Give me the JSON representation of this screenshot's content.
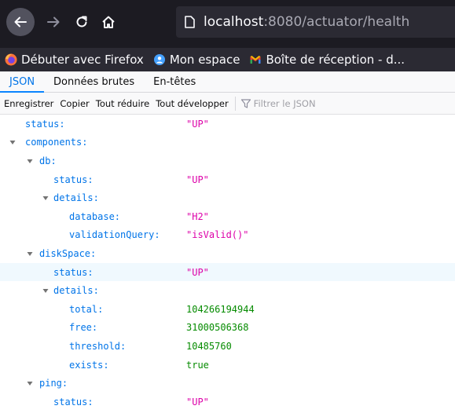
{
  "browser": {
    "url_host": "localhost",
    "url_rest": ":8080/actuator/health",
    "bookmarks": [
      {
        "label": "Débuter avec Firefox",
        "icon": "firefox-icon"
      },
      {
        "label": "Mon espace",
        "icon": "mon-espace-icon"
      },
      {
        "label": "Boîte de réception - d...",
        "icon": "gmail-icon"
      }
    ]
  },
  "viewer": {
    "tabs": [
      "JSON",
      "Données brutes",
      "En-têtes"
    ],
    "active_tab": "JSON",
    "actions": {
      "save": "Enregistrer",
      "copy": "Copier",
      "collapse_all": "Tout réduire",
      "expand_all": "Tout développer",
      "filter_placeholder": "Filtrer le JSON"
    }
  },
  "tree": [
    {
      "key": "status:",
      "value": "\"UP\"",
      "type": "str",
      "depth": 0,
      "expandable": false
    },
    {
      "key": "components:",
      "value": "",
      "type": "obj",
      "depth": 0,
      "expandable": true
    },
    {
      "key": "db:",
      "value": "",
      "type": "obj",
      "depth": 1,
      "expandable": true
    },
    {
      "key": "status:",
      "value": "\"UP\"",
      "type": "str",
      "depth": 2,
      "expandable": false
    },
    {
      "key": "details:",
      "value": "",
      "type": "obj",
      "depth": 2,
      "expandable": true
    },
    {
      "key": "database:",
      "value": "\"H2\"",
      "type": "str",
      "depth": 3,
      "expandable": false
    },
    {
      "key": "validationQuery:",
      "value": "\"isValid()\"",
      "type": "str",
      "depth": 3,
      "expandable": false
    },
    {
      "key": "diskSpace:",
      "value": "",
      "type": "obj",
      "depth": 1,
      "expandable": true
    },
    {
      "key": "status:",
      "value": "\"UP\"",
      "type": "str",
      "depth": 2,
      "expandable": false,
      "highlight": true
    },
    {
      "key": "details:",
      "value": "",
      "type": "obj",
      "depth": 2,
      "expandable": true
    },
    {
      "key": "total:",
      "value": "104266194944",
      "type": "num",
      "depth": 3,
      "expandable": false
    },
    {
      "key": "free:",
      "value": "31000506368",
      "type": "num",
      "depth": 3,
      "expandable": false
    },
    {
      "key": "threshold:",
      "value": "10485760",
      "type": "num",
      "depth": 3,
      "expandable": false
    },
    {
      "key": "exists:",
      "value": "true",
      "type": "bool",
      "depth": 3,
      "expandable": false
    },
    {
      "key": "ping:",
      "value": "",
      "type": "obj",
      "depth": 1,
      "expandable": true
    },
    {
      "key": "status:",
      "value": "\"UP\"",
      "type": "str",
      "depth": 2,
      "expandable": false
    }
  ],
  "colors": {
    "chrome_bg": "#1c1b22",
    "bookmarks_bg": "#2b2a33",
    "key": "#0074e8",
    "string": "#dd00a9",
    "number": "#058b00",
    "active_tab": "#0074e8"
  }
}
